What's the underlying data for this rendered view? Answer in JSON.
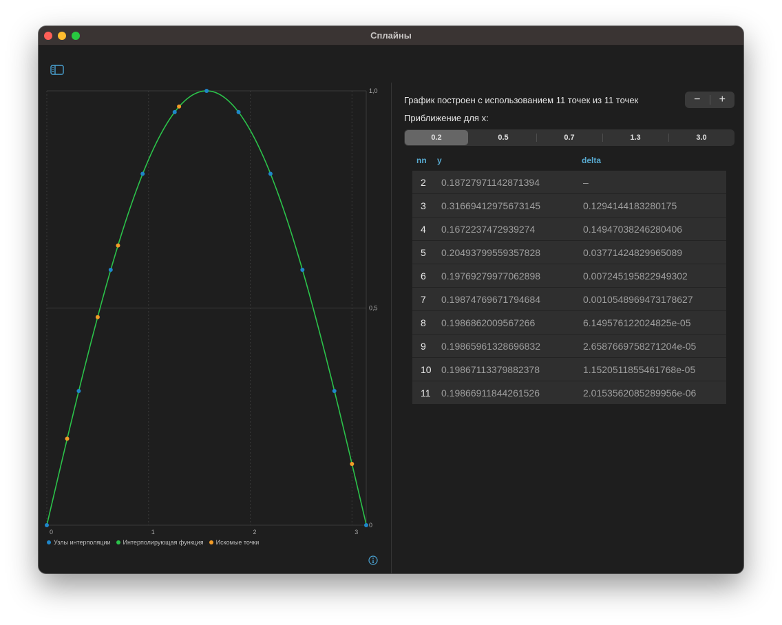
{
  "window": {
    "title": "Сплайны"
  },
  "chart_data": {
    "type": "line",
    "xlim": [
      0,
      3.14
    ],
    "ylim": [
      0,
      1.0
    ],
    "x_ticks": [
      "0",
      "1",
      "2",
      "3"
    ],
    "y_ticks": [
      "0",
      "0,5",
      "1,0"
    ],
    "grid": true,
    "legend": [
      {
        "name": "Узлы интерполяции",
        "color": "#1f86c9"
      },
      {
        "name": "Интерполирующая функция",
        "color": "#2bc24a"
      },
      {
        "name": "Искомые точки",
        "color": "#f39c27"
      }
    ],
    "series": [
      {
        "name": "Узлы интерполяции",
        "kind": "points",
        "color": "#1f86c9",
        "x": [
          0,
          0.314,
          0.628,
          0.942,
          1.257,
          1.571,
          1.885,
          2.199,
          2.513,
          2.827,
          3.14
        ],
        "y": [
          0,
          0.309,
          0.588,
          0.809,
          0.951,
          1.0,
          0.951,
          0.809,
          0.588,
          0.309,
          0
        ]
      },
      {
        "name": "Искомые точки",
        "kind": "points",
        "color": "#f39c27",
        "x": [
          0.2,
          0.5,
          0.7,
          1.3,
          3.0
        ],
        "y": [
          0.199,
          0.479,
          0.644,
          0.964,
          0.141
        ]
      },
      {
        "name": "Интерполирующая функция",
        "kind": "line",
        "color": "#2bc24a",
        "function": "sin",
        "x_range": [
          0,
          3.14
        ]
      }
    ]
  },
  "info_icon": "info-circle-icon",
  "sidebar_icon": "sidebar-toggle-icon",
  "right": {
    "summary": "График построен с использованием 11 точек из 11 точек",
    "stepper": {
      "minus": "−",
      "plus": "+"
    },
    "approx_label": "Приближение для x:",
    "segments": [
      "0.2",
      "0.5",
      "0.7",
      "1.3",
      "3.0"
    ],
    "selected_segment": "0.2",
    "table": {
      "headers": {
        "nn": "nn",
        "y": "y",
        "delta": "delta"
      },
      "rows": [
        {
          "nn": "2",
          "y": "0.18727971142871394",
          "delta": "–"
        },
        {
          "nn": "3",
          "y": "0.31669412975673145",
          "delta": "0.1294144183280175"
        },
        {
          "nn": "4",
          "y": "0.1672237472939274",
          "delta": "0.14947038246280406"
        },
        {
          "nn": "5",
          "y": "0.20493799559357828",
          "delta": "0.03771424829965089"
        },
        {
          "nn": "6",
          "y": "0.19769279977062898",
          "delta": "0.007245195822949302"
        },
        {
          "nn": "7",
          "y": "0.19874769671794684",
          "delta": "0.0010548969473178627"
        },
        {
          "nn": "8",
          "y": "0.1986862009567266",
          "delta": "6.149576122024825e-05"
        },
        {
          "nn": "9",
          "y": "0.19865961328696832",
          "delta": "2.6587669758271204e-05"
        },
        {
          "nn": "10",
          "y": "0.19867113379882378",
          "delta": "1.1520511855461768e-05"
        },
        {
          "nn": "11",
          "y": "0.19866911844261526",
          "delta": "2.0153562085289956e-06"
        }
      ]
    }
  }
}
